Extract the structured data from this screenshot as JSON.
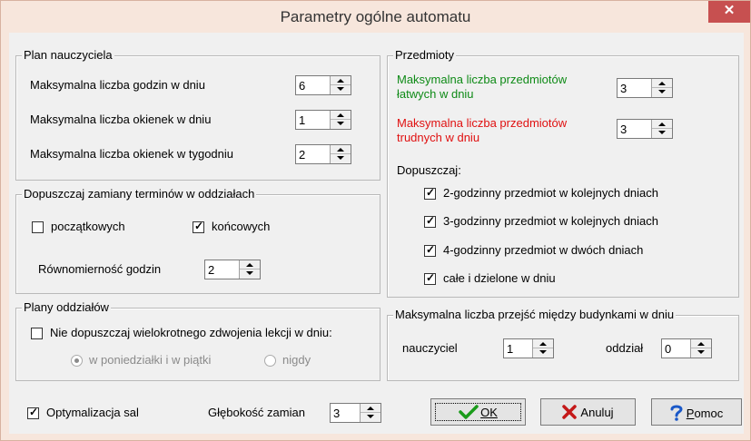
{
  "window": {
    "title": "Parametry ogólne automatu",
    "close_glyph": "✕"
  },
  "plan": {
    "legend": "Plan nauczyciela",
    "rows": [
      {
        "label": "Maksymalna liczba godzin w dniu",
        "value": "6"
      },
      {
        "label": "Maksymalna liczba okienek w dniu",
        "value": "1"
      },
      {
        "label": "Maksymalna liczba okienek w tygodniu",
        "value": "2"
      }
    ]
  },
  "zamiany": {
    "legend": "Dopuszczaj zamiany terminów w oddziałach",
    "poczatkowych": {
      "label": "początkowych",
      "checked": false
    },
    "koncowych": {
      "label": "końcowych",
      "checked": true
    },
    "rownomiernosc": {
      "label": "Równomierność godzin",
      "value": "2"
    }
  },
  "oddzialy": {
    "legend": "Plany oddziałów",
    "nie_dopuszczaj": {
      "label": "Nie dopuszczaj wielokrotnego zdwojenia lekcji w dniu:",
      "checked": false
    },
    "radio_options": [
      {
        "label": "w poniedziałki i w piątki",
        "selected": true
      },
      {
        "label": "nigdy",
        "selected": false
      }
    ]
  },
  "przedmioty": {
    "legend": "Przedmioty",
    "latwe": {
      "label_line1": "Maksymalna liczba przedmiotów",
      "label_line2": "łatwych w dniu",
      "value": "3",
      "color": "#0e8a16"
    },
    "trudne": {
      "label_line1": "Maksymalna liczba przedmiotów",
      "label_line2": "trudnych w dniu",
      "value": "3",
      "color": "#e01010"
    },
    "dopuszczaj_label": "Dopuszczaj:",
    "options": [
      {
        "label": "2-godzinny przedmiot w kolejnych dniach",
        "checked": true
      },
      {
        "label": "3-godzinny przedmiot w kolejnych dniach",
        "checked": true
      },
      {
        "label": "4-godzinny przedmiot w dwóch dniach",
        "checked": true
      },
      {
        "label": "całe i dzielone w dniu",
        "checked": true
      }
    ]
  },
  "przejscia": {
    "legend": "Maksymalna liczba przejść między budynkami w dniu",
    "nauczyciel": {
      "label": "nauczyciel",
      "value": "1"
    },
    "oddzial": {
      "label": "oddział",
      "value": "0"
    }
  },
  "bottom": {
    "optymalizacja": {
      "label": "Optymalizacja sal",
      "checked": true
    },
    "glebokosc": {
      "label": "Głębokość zamian",
      "value": "3"
    }
  },
  "buttons": {
    "ok": {
      "label": "OK",
      "icon": "check-icon",
      "color": "#1a9b1a"
    },
    "anuluj": {
      "label": "Anuluj",
      "icon": "x-icon",
      "color": "#c41818"
    },
    "pomoc": {
      "label_first": "P",
      "label_rest": "omoc",
      "icon": "question-icon",
      "color": "#1a58c8"
    }
  },
  "check_glyph": "✓"
}
